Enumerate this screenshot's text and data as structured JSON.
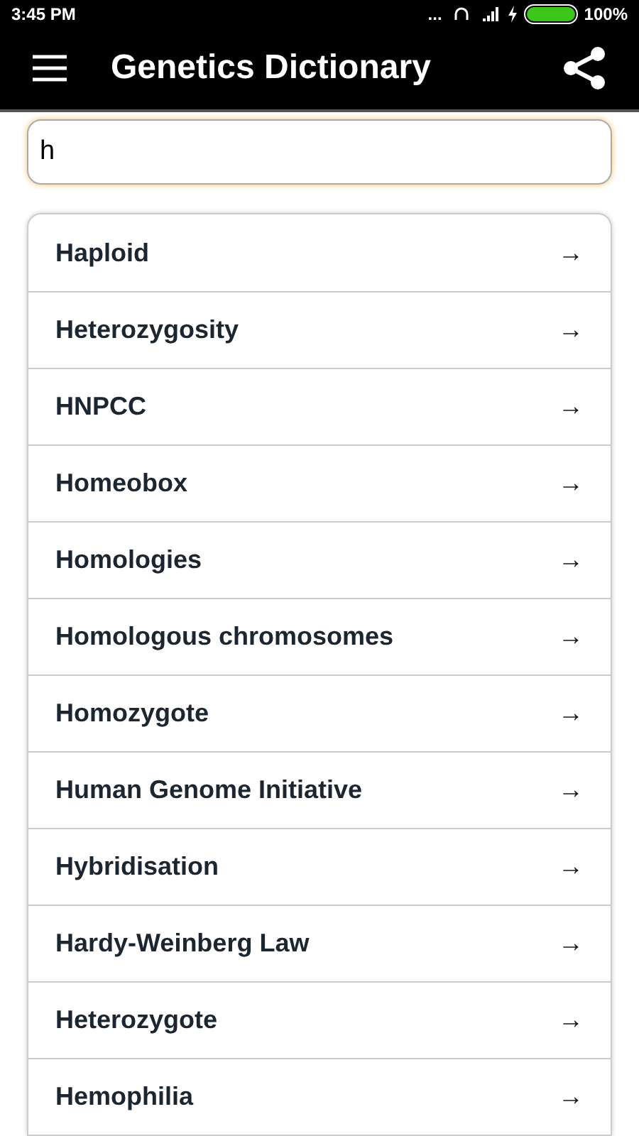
{
  "status_bar": {
    "time": "3:45 PM",
    "dots": "...",
    "battery": {
      "percent": "100%",
      "level": 1
    }
  },
  "app_bar": {
    "title": "Genetics Dictionary"
  },
  "search": {
    "value": "h"
  },
  "terms": [
    {
      "label": "Haploid",
      "arrow": "→"
    },
    {
      "label": "Heterozygosity",
      "arrow": "→"
    },
    {
      "label": "HNPCC",
      "arrow": "→"
    },
    {
      "label": "Homeobox",
      "arrow": "→"
    },
    {
      "label": "Homologies",
      "arrow": "→"
    },
    {
      "label": "Homologous chromosomes",
      "arrow": "→"
    },
    {
      "label": "Homozygote",
      "arrow": "→"
    },
    {
      "label": "Human Genome Initiative",
      "arrow": "→"
    },
    {
      "label": "Hybridisation",
      "arrow": "→"
    },
    {
      "label": "Hardy-Weinberg Law",
      "arrow": "→"
    },
    {
      "label": "Heterozygote",
      "arrow": "→"
    },
    {
      "label": "Hemophilia",
      "arrow": "→"
    }
  ]
}
